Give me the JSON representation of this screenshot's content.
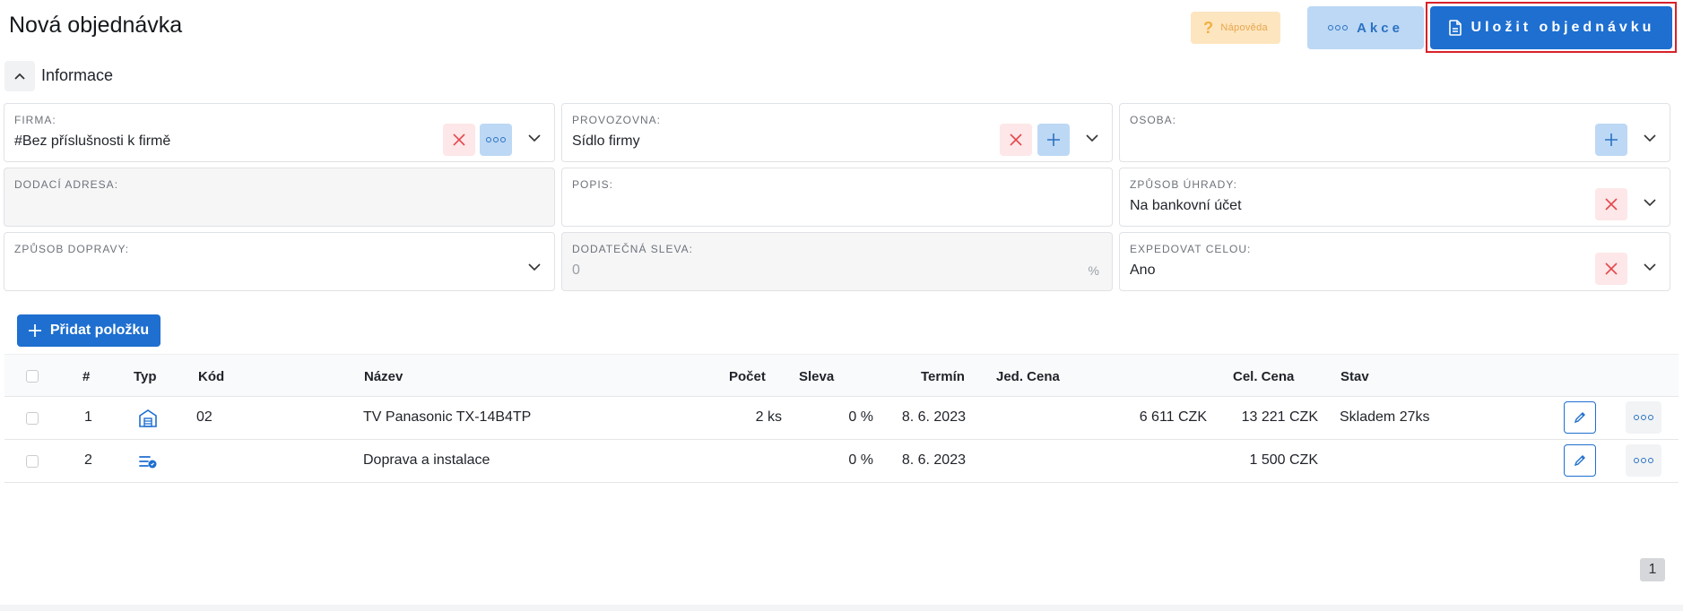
{
  "header": {
    "title": "Nová objednávka",
    "help_label": "Nápověda",
    "akce_label": "Akce",
    "save_label": "Uložit objednávku"
  },
  "section": {
    "title": "Informace"
  },
  "form": {
    "firma": {
      "label": "FIRMA:",
      "value": "#Bez příslušnosti k firmě"
    },
    "provozovna": {
      "label": "PROVOZOVNA:",
      "value": "Sídlo firmy"
    },
    "osoba": {
      "label": "OSOBA:",
      "value": ""
    },
    "dodaci_adresa": {
      "label": "DODACÍ ADRESA:",
      "value": ""
    },
    "popis": {
      "label": "POPIS:",
      "value": ""
    },
    "zpusob_uhrady": {
      "label": "ZPŮSOB ÚHRADY:",
      "value": "Na bankovní účet"
    },
    "zpusob_dopravy": {
      "label": "ZPŮSOB DOPRAVY:",
      "value": ""
    },
    "dodatecna_sleva": {
      "label": "DODATEČNÁ SLEVA:",
      "value": "0",
      "unit": "%"
    },
    "expedovat_celou": {
      "label": "EXPEDOVAT CELOU:",
      "value": "Ano"
    }
  },
  "items": {
    "add_label": "Přidat položku",
    "columns": {
      "num": "#",
      "typ": "Typ",
      "kod": "Kód",
      "nazev": "Název",
      "pocet": "Počet",
      "sleva": "Sleva",
      "termin": "Termín",
      "jed_cena": "Jed. Cena",
      "cel_cena": "Cel. Cena",
      "stav": "Stav"
    },
    "rows": [
      {
        "num": "1",
        "type_icon": "warehouse-icon",
        "kod": "02",
        "nazev": "TV Panasonic TX-14B4TP",
        "pocet": "2 ks",
        "sleva": "0 %",
        "termin": "8. 6. 2023",
        "jed_cena": "6 611 CZK",
        "cel_cena": "13 221 CZK",
        "stav": "Skladem 27ks"
      },
      {
        "num": "2",
        "type_icon": "service-icon",
        "kod": "",
        "nazev": "Doprava a instalace",
        "pocet": "",
        "sleva": "0 %",
        "termin": "8. 6. 2023",
        "jed_cena": "",
        "cel_cena": "1 500 CZK",
        "stav": ""
      }
    ],
    "page": "1"
  },
  "colors": {
    "primary": "#1e6fd0",
    "primary_light": "#bcd8f5",
    "danger": "#e5484d",
    "danger_light": "#fde7e8",
    "warning_light": "#fde5bf",
    "highlight_border": "#d9212a"
  }
}
